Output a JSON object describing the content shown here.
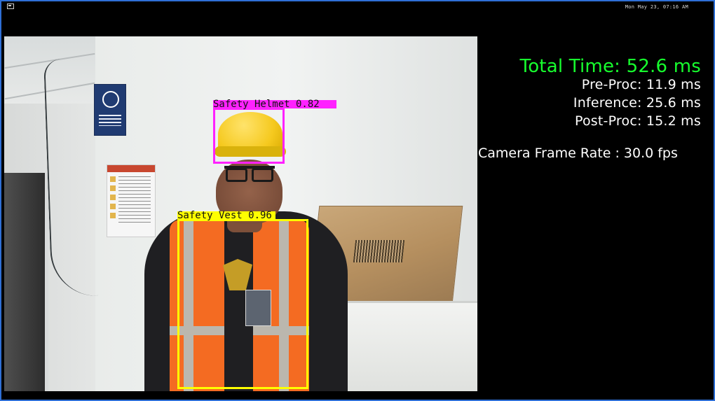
{
  "window": {
    "clock": "Mon May 23, 07:16 AM"
  },
  "detections": {
    "helmet_label": "Safety Helmet  0.82",
    "vest_label": "Safety Vest 0.96"
  },
  "stats": {
    "total_time": "Total Time: 52.6 ms",
    "pre_proc": "Pre-Proc: 11.9 ms",
    "inference": "Inference: 25.6 ms",
    "post_proc": "Post-Proc: 15.2 ms",
    "camera_fps": "Camera Frame Rate : 30.0 fps"
  },
  "colors": {
    "helmet": "#ff22ff",
    "vest": "#ffff00",
    "total_time": "#17ff2e"
  }
}
